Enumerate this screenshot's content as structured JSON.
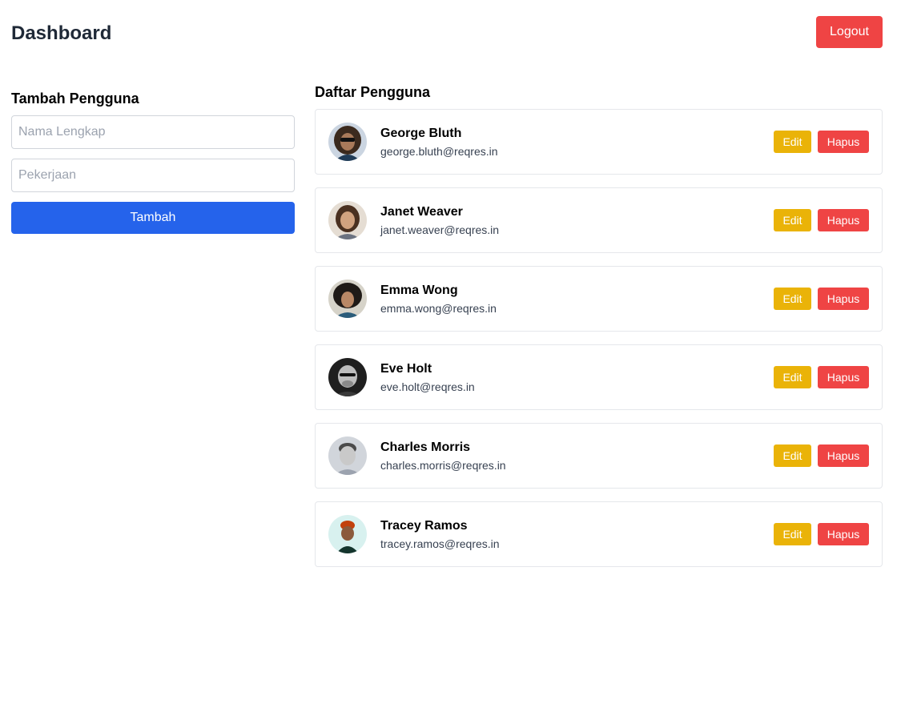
{
  "header": {
    "title": "Dashboard",
    "logout_label": "Logout"
  },
  "add_user_form": {
    "title": "Tambah Pengguna",
    "name_field": {
      "value": "",
      "placeholder": "Nama Lengkap"
    },
    "job_field": {
      "value": "",
      "placeholder": "Pekerjaan"
    },
    "submit_label": "Tambah"
  },
  "user_list": {
    "title": "Daftar Pengguna",
    "edit_label": "Edit",
    "delete_label": "Hapus",
    "users": [
      {
        "name": "George Bluth",
        "email": "george.bluth@reqres.in",
        "avatar_icon": "avatar-photo-icon"
      },
      {
        "name": "Janet Weaver",
        "email": "janet.weaver@reqres.in",
        "avatar_icon": "avatar-photo-icon"
      },
      {
        "name": "Emma Wong",
        "email": "emma.wong@reqres.in",
        "avatar_icon": "avatar-photo-icon"
      },
      {
        "name": "Eve Holt",
        "email": "eve.holt@reqres.in",
        "avatar_icon": "avatar-photo-icon"
      },
      {
        "name": "Charles Morris",
        "email": "charles.morris@reqres.in",
        "avatar_icon": "avatar-photo-icon"
      },
      {
        "name": "Tracey Ramos",
        "email": "tracey.ramos@reqres.in",
        "avatar_icon": "avatar-photo-icon"
      }
    ]
  },
  "colors": {
    "primary": "#2563eb",
    "danger": "#ef4444",
    "warning": "#eab308",
    "title_text": "#1f2937"
  }
}
